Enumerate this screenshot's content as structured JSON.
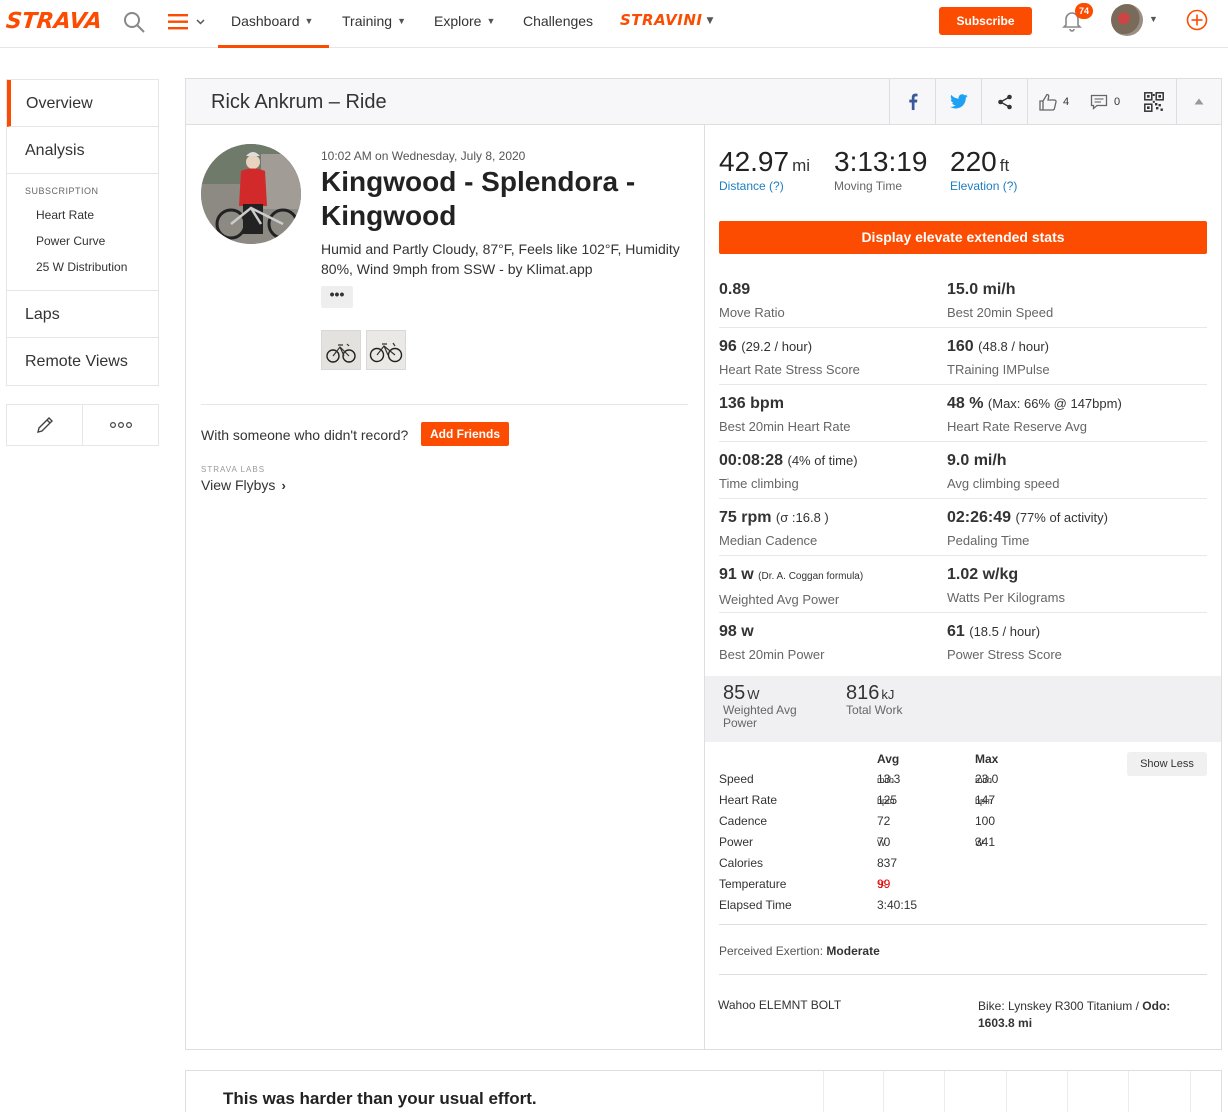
{
  "nav": {
    "logo": "STRAVA",
    "items": [
      {
        "label": "Dashboard"
      },
      {
        "label": "Training"
      },
      {
        "label": "Explore"
      },
      {
        "label": "Challenges"
      }
    ],
    "stravini": "STRAVINI",
    "subscribe_label": "Subscribe",
    "notification_count": "74",
    "accent_color": "#fc4c02"
  },
  "sidebar": {
    "items": [
      {
        "label": "Overview"
      },
      {
        "label": "Analysis"
      },
      {
        "label": "Laps"
      },
      {
        "label": "Remote Views"
      }
    ],
    "subscription_heading": "SUBSCRIPTION",
    "subscription_items": [
      {
        "label": "Heart Rate"
      },
      {
        "label": "Power Curve"
      },
      {
        "label": "25 W Distribution"
      }
    ]
  },
  "header": {
    "title": "Rick Ankrum – Ride",
    "kudos_count": "4",
    "comment_count": "0"
  },
  "activity": {
    "datetime": "10:02 AM on Wednesday, July 8, 2020",
    "title": "Kingwood - Splendora - Kingwood",
    "description": "Humid and Partly Cloudy, 87°F, Feels like 102°F, Humidity 80%, Wind 9mph from SSW - by Klimat.app",
    "more_label": "•••",
    "no_record_text": "With someone who didn't record?",
    "add_friends_label": "Add Friends",
    "labs_label": "STRAVA LABS",
    "flybys_label": "View Flybys"
  },
  "primary_stats": [
    {
      "value": "42.97",
      "unit": "mi",
      "label": "Distance (?)"
    },
    {
      "value": "3:13:19",
      "unit": "",
      "label": "Moving Time"
    },
    {
      "value": "220",
      "unit": "ft",
      "label": "Elevation (?)"
    }
  ],
  "elevate_button": "Display elevate extended stats",
  "extended_stats": [
    {
      "left": {
        "value": "0.89",
        "extra": "",
        "label": "Move Ratio"
      },
      "right": {
        "value": "15.0 mi/h",
        "extra": "",
        "label": "Best 20min Speed"
      }
    },
    {
      "left": {
        "value": "96",
        "extra": "(29.2 / hour)",
        "label": "Heart Rate Stress Score"
      },
      "right": {
        "value": "160",
        "extra": "(48.8 / hour)",
        "label": "TRaining IMPulse"
      }
    },
    {
      "left": {
        "value": "136 bpm",
        "extra": "",
        "label": "Best 20min Heart Rate"
      },
      "right": {
        "value": "48 %",
        "extra": "(Max: 66% @ 147bpm)",
        "label": "Heart Rate Reserve Avg"
      }
    },
    {
      "left": {
        "value": "00:08:28",
        "extra": "(4% of time)",
        "label": "Time climbing"
      },
      "right": {
        "value": "9.0 mi/h",
        "extra": "",
        "label": "Avg climbing speed"
      }
    },
    {
      "left": {
        "value": "75 rpm",
        "extra": "(σ :16.8 )",
        "label": "Median Cadence"
      },
      "right": {
        "value": "02:26:49",
        "extra": "(77% of activity)",
        "label": "Pedaling Time"
      }
    },
    {
      "left": {
        "value": "91 w",
        "extra": "(Dr. A. Coggan formula)",
        "label": "Weighted Avg Power"
      },
      "right": {
        "value": "1.02 w/kg",
        "extra": "",
        "label": "Watts Per Kilograms"
      }
    },
    {
      "left": {
        "value": "98 w",
        "extra": "",
        "label": "Best 20min Power"
      },
      "right": {
        "value": "61",
        "extra": "(18.5 / hour)",
        "label": "Power Stress Score"
      }
    }
  ],
  "secondary_stats": [
    {
      "value": "85",
      "unit": "W",
      "label_1": "Weighted Avg",
      "label_2": "Power"
    },
    {
      "value": "816",
      "unit": "kJ",
      "label_1": "Total Work",
      "label_2": ""
    }
  ],
  "more_stats": {
    "col_avg": "Avg",
    "col_max": "Max",
    "show_less_label": "Show Less",
    "rows": [
      {
        "label": "Speed",
        "avg": "13.3",
        "avg_unit": "mi/h",
        "max": "23.0",
        "max_unit": "mi/h"
      },
      {
        "label": "Heart Rate",
        "avg": "125",
        "avg_unit": "bpm",
        "max": "147",
        "max_unit": "bpm"
      },
      {
        "label": "Cadence",
        "avg": "72",
        "avg_unit": "",
        "max": "100",
        "max_unit": ""
      },
      {
        "label": "Power",
        "avg": "70",
        "avg_unit": "W",
        "max": "341",
        "max_unit": "W"
      },
      {
        "label": "Calories",
        "avg": "837",
        "avg_unit": "",
        "max": "",
        "max_unit": ""
      },
      {
        "label": "Temperature",
        "avg": "99",
        "avg_unit": "°F",
        "max": "",
        "max_unit": ""
      },
      {
        "label": "Elapsed Time",
        "avg": "3:40:15",
        "avg_unit": "",
        "max": "",
        "max_unit": ""
      }
    ],
    "temperature_color": "#e00000"
  },
  "exertion": {
    "label": "Perceived Exertion:",
    "value": "Moderate"
  },
  "device": "Wahoo ELEMNT BOLT",
  "bike": {
    "prefix": "Bike: Lynskey R300 Titanium / ",
    "odo_label": "Odo:",
    "odo_value": "1603.8 mi"
  },
  "bottom_card": {
    "text": "This was harder than your usual effort."
  }
}
